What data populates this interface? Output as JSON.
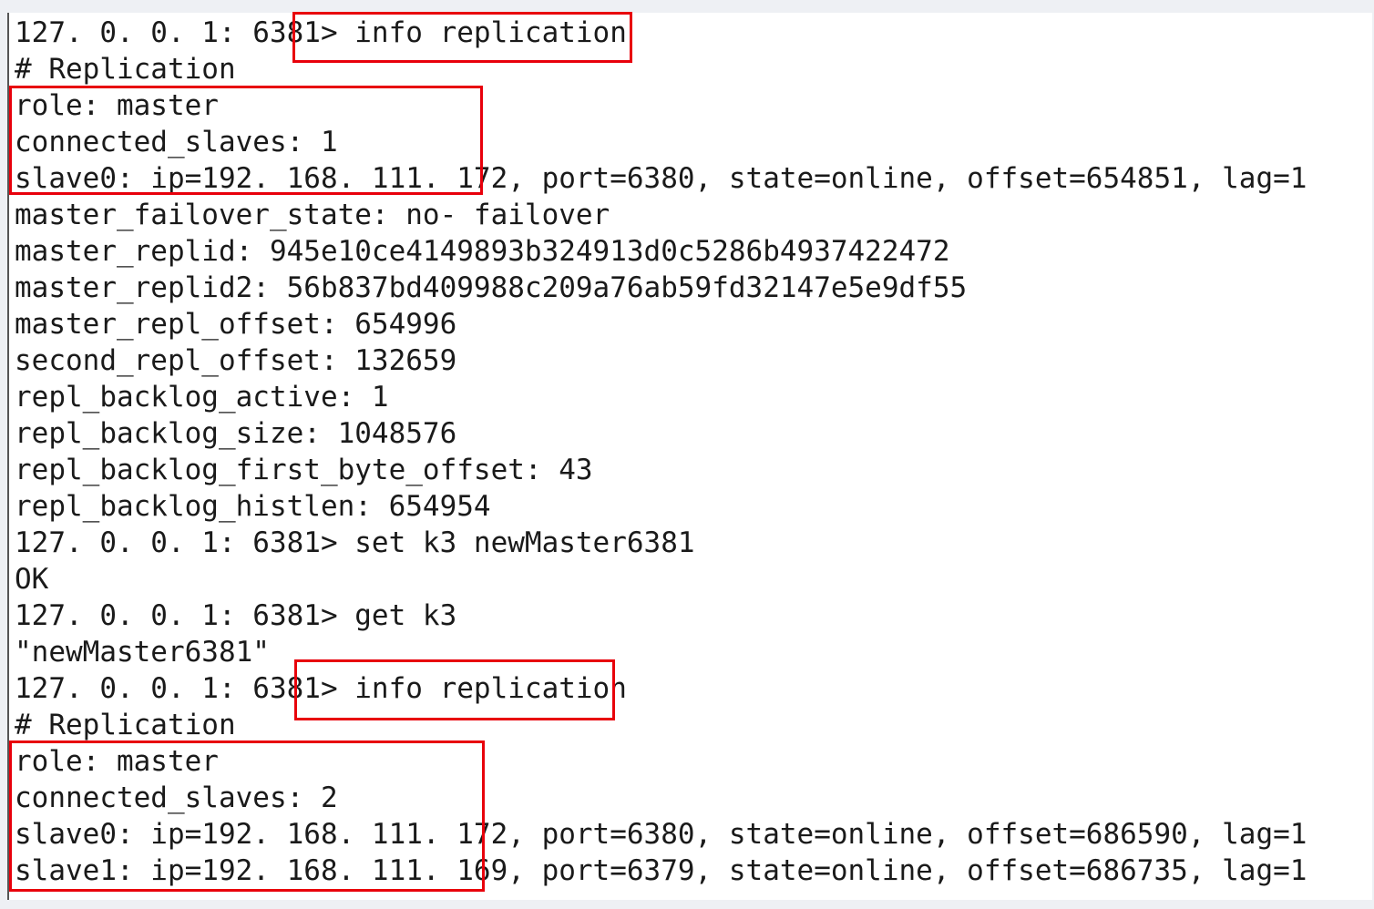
{
  "terminal": {
    "lines": [
      "127. 0. 0. 1: 6381> info replication",
      "# Replication",
      "role: master",
      "connected_slaves: 1",
      "slave0: ip=192. 168. 111. 172, port=6380, state=online, offset=654851, lag=1",
      "master_failover_state: no- failover",
      "master_replid: 945e10ce4149893b324913d0c5286b4937422472",
      "master_replid2: 56b837bd409988c209a76ab59fd32147e5e9df55",
      "master_repl_offset: 654996",
      "second_repl_offset: 132659",
      "repl_backlog_active: 1",
      "repl_backlog_size: 1048576",
      "repl_backlog_first_byte_offset: 43",
      "repl_backlog_histlen: 654954",
      "127. 0. 0. 1: 6381> set k3 newMaster6381",
      "OK",
      "127. 0. 0. 1: 6381> get k3",
      "\"newMaster6381\"",
      "127. 0. 0. 1: 6381> info replication",
      "# Replication",
      "role: master",
      "connected_slaves: 2",
      "slave0: ip=192. 168. 111. 172, port=6380, state=online, offset=686590, lag=1",
      "slave1: ip=192. 168. 111. 169, port=6379, state=online, offset=686735, lag=1"
    ]
  },
  "annotation_color": "#e8000b"
}
